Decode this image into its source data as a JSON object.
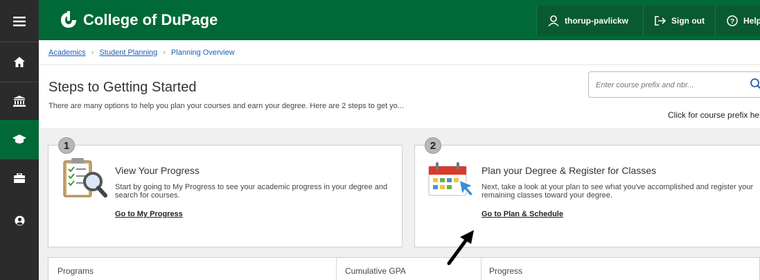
{
  "nav": {
    "items": [
      {
        "icon": "hamburger-menu-icon"
      },
      {
        "icon": "home-icon"
      },
      {
        "icon": "bank-icon"
      },
      {
        "icon": "graduation-cap-icon",
        "active": true
      },
      {
        "icon": "briefcase-icon"
      },
      {
        "icon": "user-circle-icon"
      }
    ]
  },
  "header": {
    "logo_text": "College of DuPage",
    "user_name": "thorup-pavlickw",
    "sign_out_label": "Sign out",
    "help_label": "Help",
    "brand_color": "#006937"
  },
  "breadcrumb": {
    "items": [
      "Academics",
      "Student Planning",
      "Planning Overview"
    ]
  },
  "steps": {
    "title": "Steps to Getting Started",
    "subtitle": "There are many options to help you plan your courses and earn your degree. Here are 2 steps to get yo...",
    "search_placeholder": "Enter course prefix and nbr...",
    "help_link": "Click for course prefix he",
    "cards": [
      {
        "number": "1",
        "title": "View Your Progress",
        "description": "Start by going to My Progress to see your academic progress in your degree and search for courses.",
        "link": "Go to My Progress"
      },
      {
        "number": "2",
        "title": "Plan your Degree & Register for Classes",
        "description": "Next, take a look at your plan to see what you've accomplished and register your remaining classes toward your degree.",
        "link": "Go to Plan & Schedule"
      }
    ]
  },
  "programs_table": {
    "headers": [
      "Programs",
      "Cumulative GPA",
      "Progress"
    ]
  }
}
